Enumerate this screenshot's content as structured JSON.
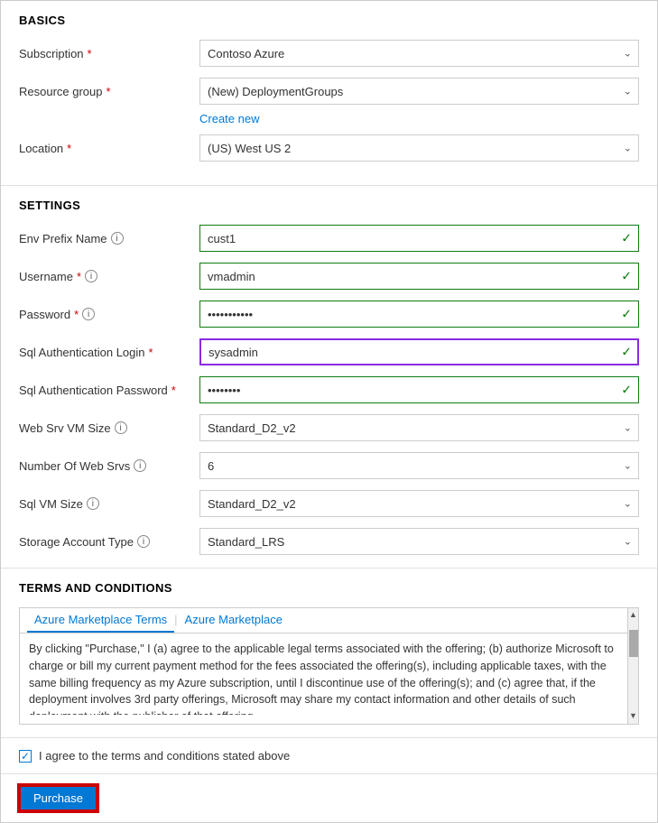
{
  "basics": {
    "title": "BASICS",
    "subscription": {
      "label": "Subscription",
      "required": true,
      "value": "Contoso Azure"
    },
    "resource_group": {
      "label": "Resource group",
      "required": true,
      "value": "(New) DeploymentGroups",
      "create_new_label": "Create new"
    },
    "location": {
      "label": "Location",
      "required": true,
      "value": "(US) West US 2"
    }
  },
  "settings": {
    "title": "SETTINGS",
    "env_prefix_name": {
      "label": "Env Prefix Name",
      "value": "cust1",
      "has_info": true
    },
    "username": {
      "label": "Username",
      "required": true,
      "value": "vmadmin",
      "has_info": true
    },
    "password": {
      "label": "Password",
      "required": true,
      "value": "···········",
      "has_info": true
    },
    "sql_auth_login": {
      "label": "Sql Authentication Login",
      "required": true,
      "value": "sysadmin",
      "active": true
    },
    "sql_auth_password": {
      "label": "Sql Authentication Password",
      "required": true,
      "value": "········"
    },
    "web_srv_vm_size": {
      "label": "Web Srv VM Size",
      "value": "Standard_D2_v2",
      "has_info": true
    },
    "number_of_web_srvs": {
      "label": "Number Of Web Srvs",
      "value": "6",
      "has_info": true
    },
    "sql_vm_size": {
      "label": "Sql VM Size",
      "value": "Standard_D2_v2",
      "has_info": true
    },
    "storage_account_type": {
      "label": "Storage Account Type",
      "value": "Standard_LRS",
      "has_info": true
    }
  },
  "terms": {
    "title": "TERMS AND CONDITIONS",
    "tab1": "Azure Marketplace Terms",
    "tab2": "Azure Marketplace",
    "content": "By clicking \"Purchase,\" I (a) agree to the applicable legal terms associated with the offering; (b) authorize Microsoft to charge or bill my current payment method for the fees associated the offering(s), including applicable taxes, with the same billing frequency as my Azure subscription, until I discontinue use of the offering(s); and (c) agree that, if the deployment involves 3rd party offerings, Microsoft may share my contact information and other details of such deployment with the publisher of that offering."
  },
  "agree": {
    "label": "I agree to the terms and conditions stated above",
    "checked": true
  },
  "purchase": {
    "label": "Purchase"
  }
}
